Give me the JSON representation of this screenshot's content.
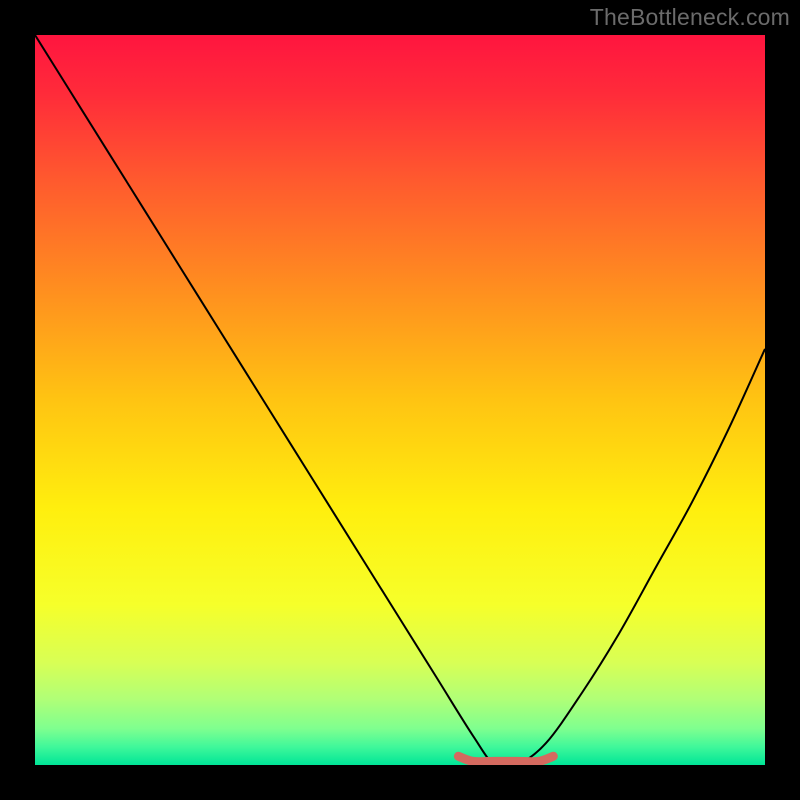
{
  "watermark": "TheBottleneck.com",
  "plot": {
    "inner_x": 35,
    "inner_y": 35,
    "inner_w": 730,
    "inner_h": 730
  },
  "chart_data": {
    "type": "line",
    "title": "",
    "xlabel": "",
    "ylabel": "",
    "xlim": [
      0,
      100
    ],
    "ylim": [
      0,
      100
    ],
    "series": [
      {
        "name": "bottleneck-curve",
        "x": [
          0,
          5,
          10,
          15,
          20,
          25,
          30,
          35,
          40,
          45,
          50,
          55,
          60,
          63,
          66,
          70,
          75,
          80,
          85,
          90,
          95,
          100
        ],
        "values": [
          100,
          92,
          84,
          76,
          68,
          60,
          52,
          44,
          36,
          28,
          20,
          12,
          4,
          0,
          0,
          3,
          10,
          18,
          27,
          36,
          46,
          57
        ]
      },
      {
        "name": "optimal-range-marker",
        "x": [
          58,
          60,
          63,
          66,
          69,
          71
        ],
        "values": [
          1.2,
          0.5,
          0.5,
          0.5,
          0.5,
          1.2
        ]
      }
    ],
    "gradient_stops": [
      {
        "offset": 0.0,
        "color": "#ff153f"
      },
      {
        "offset": 0.08,
        "color": "#ff2b3a"
      },
      {
        "offset": 0.2,
        "color": "#ff5a2e"
      },
      {
        "offset": 0.35,
        "color": "#ff8f1f"
      },
      {
        "offset": 0.5,
        "color": "#ffc412"
      },
      {
        "offset": 0.65,
        "color": "#ffef0e"
      },
      {
        "offset": 0.78,
        "color": "#f6ff2a"
      },
      {
        "offset": 0.86,
        "color": "#d8ff55"
      },
      {
        "offset": 0.91,
        "color": "#b0ff77"
      },
      {
        "offset": 0.95,
        "color": "#7fff8f"
      },
      {
        "offset": 0.975,
        "color": "#40f89a"
      },
      {
        "offset": 1.0,
        "color": "#00e597"
      }
    ],
    "marker_color": "#d46a5f",
    "curve_color": "#000000"
  }
}
